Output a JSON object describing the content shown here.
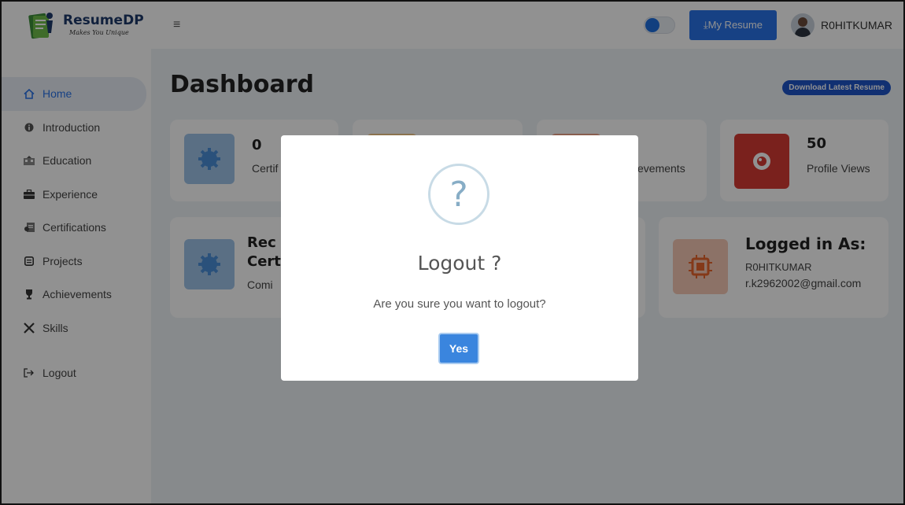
{
  "brand": {
    "name": "ResumeDP",
    "tagline": "Makes You Unique"
  },
  "topbar": {
    "menu_icon": "hamburger-icon",
    "resume_button": "⤓My Resume",
    "username": "R0HITKUMAR"
  },
  "sidebar": {
    "items": [
      {
        "label": "Home",
        "icon": "home-icon",
        "active": true
      },
      {
        "label": "Introduction",
        "icon": "info-icon"
      },
      {
        "label": "Education",
        "icon": "education-icon"
      },
      {
        "label": "Experience",
        "icon": "briefcase-icon"
      },
      {
        "label": "Certifications",
        "icon": "certificate-icon"
      },
      {
        "label": "Projects",
        "icon": "project-icon"
      },
      {
        "label": "Achievements",
        "icon": "trophy-icon"
      },
      {
        "label": "Skills",
        "icon": "tools-icon"
      }
    ],
    "logout": {
      "label": "Logout",
      "icon": "logout-icon"
    }
  },
  "main": {
    "title": "Dashboard",
    "download_pill": "Download Latest Resume",
    "stats": [
      {
        "number": "0",
        "label": "Certif",
        "icon": "gear-icon",
        "color": "#9fc3e9"
      },
      {
        "number": "",
        "label": "",
        "icon": "",
        "color": "#f4c88a"
      },
      {
        "number": "",
        "label": "evements",
        "icon": "",
        "color": "#f0a48a"
      },
      {
        "number": "50",
        "label": "Profile Views",
        "icon": "eye-icon",
        "color": "#d63a34"
      }
    ],
    "recent": {
      "line1": "Rec",
      "line2": "Cert",
      "line3": "Comi",
      "icon": "gear-icon"
    },
    "logged_in": {
      "title": "Logged in As:",
      "name": "R0HITKUMAR",
      "email": "r.k2962002@gmail.com",
      "icon": "chip-icon"
    }
  },
  "modal": {
    "icon": "question-icon",
    "glyph": "?",
    "title": "Logout ?",
    "text": "Are you sure you want to logout?",
    "yes": "Yes"
  }
}
